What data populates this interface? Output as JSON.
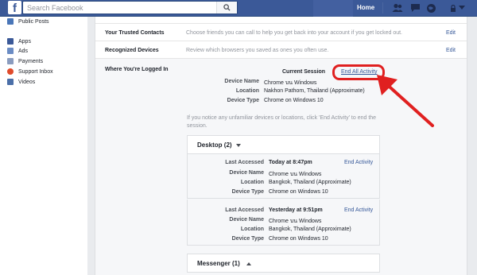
{
  "search": {
    "placeholder": "Search Facebook"
  },
  "topbar": {
    "home_label": "Home"
  },
  "sidebar": {
    "items": [
      {
        "label": "Public Posts",
        "icon": "rss-icon"
      },
      {
        "label": "Apps",
        "icon": "apps-icon"
      },
      {
        "label": "Ads",
        "icon": "ads-icon"
      },
      {
        "label": "Payments",
        "icon": "payments-icon"
      },
      {
        "label": "Support Inbox",
        "icon": "support-icon"
      },
      {
        "label": "Videos",
        "icon": "videos-icon"
      }
    ]
  },
  "settings": {
    "trusted_contacts": {
      "title": "Your Trusted Contacts",
      "desc": "Choose friends you can call to help you get back into your account if you get locked out.",
      "edit": "Edit"
    },
    "recognized_devices": {
      "title": "Recognized Devices",
      "desc": "Review which browsers you saved as ones you often use.",
      "edit": "Edit"
    },
    "logged_in": {
      "title": "Where You're Logged In",
      "current_session_label": "Current Session",
      "end_all_label": "End All Activity",
      "current": {
        "device_name_label": "Device Name",
        "device_name": "Chrome บน Windows",
        "location_label": "Location",
        "location": "Nakhon Pathom, Thailand (Approximate)",
        "device_type_label": "Device Type",
        "device_type": "Chrome on Windows 10"
      },
      "notice": "If you notice any unfamiliar devices or locations, click 'End Activity' to end the session.",
      "desktop_header": "Desktop (2)",
      "sessions": [
        {
          "last_accessed_label": "Last Accessed",
          "last_accessed": "Today at 8:47pm",
          "device_name_label": "Device Name",
          "device_name": "Chrome บน Windows",
          "location_label": "Location",
          "location": "Bangkok, Thailand (Approximate)",
          "device_type_label": "Device Type",
          "device_type": "Chrome on Windows 10",
          "end_label": "End Activity"
        },
        {
          "last_accessed_label": "Last Accessed",
          "last_accessed": "Yesterday at 9:51pm",
          "device_name_label": "Device Name",
          "device_name": "Chrome บน Windows",
          "location_label": "Location",
          "location": "Bangkok, Thailand (Approximate)",
          "device_type_label": "Device Type",
          "device_type": "Chrome on Windows 10",
          "end_label": "End Activity"
        }
      ],
      "messenger_header": "Messenger (1)"
    }
  },
  "colors": {
    "brand": "#3b5998",
    "link": "#365899",
    "annotation": "#e02020"
  }
}
